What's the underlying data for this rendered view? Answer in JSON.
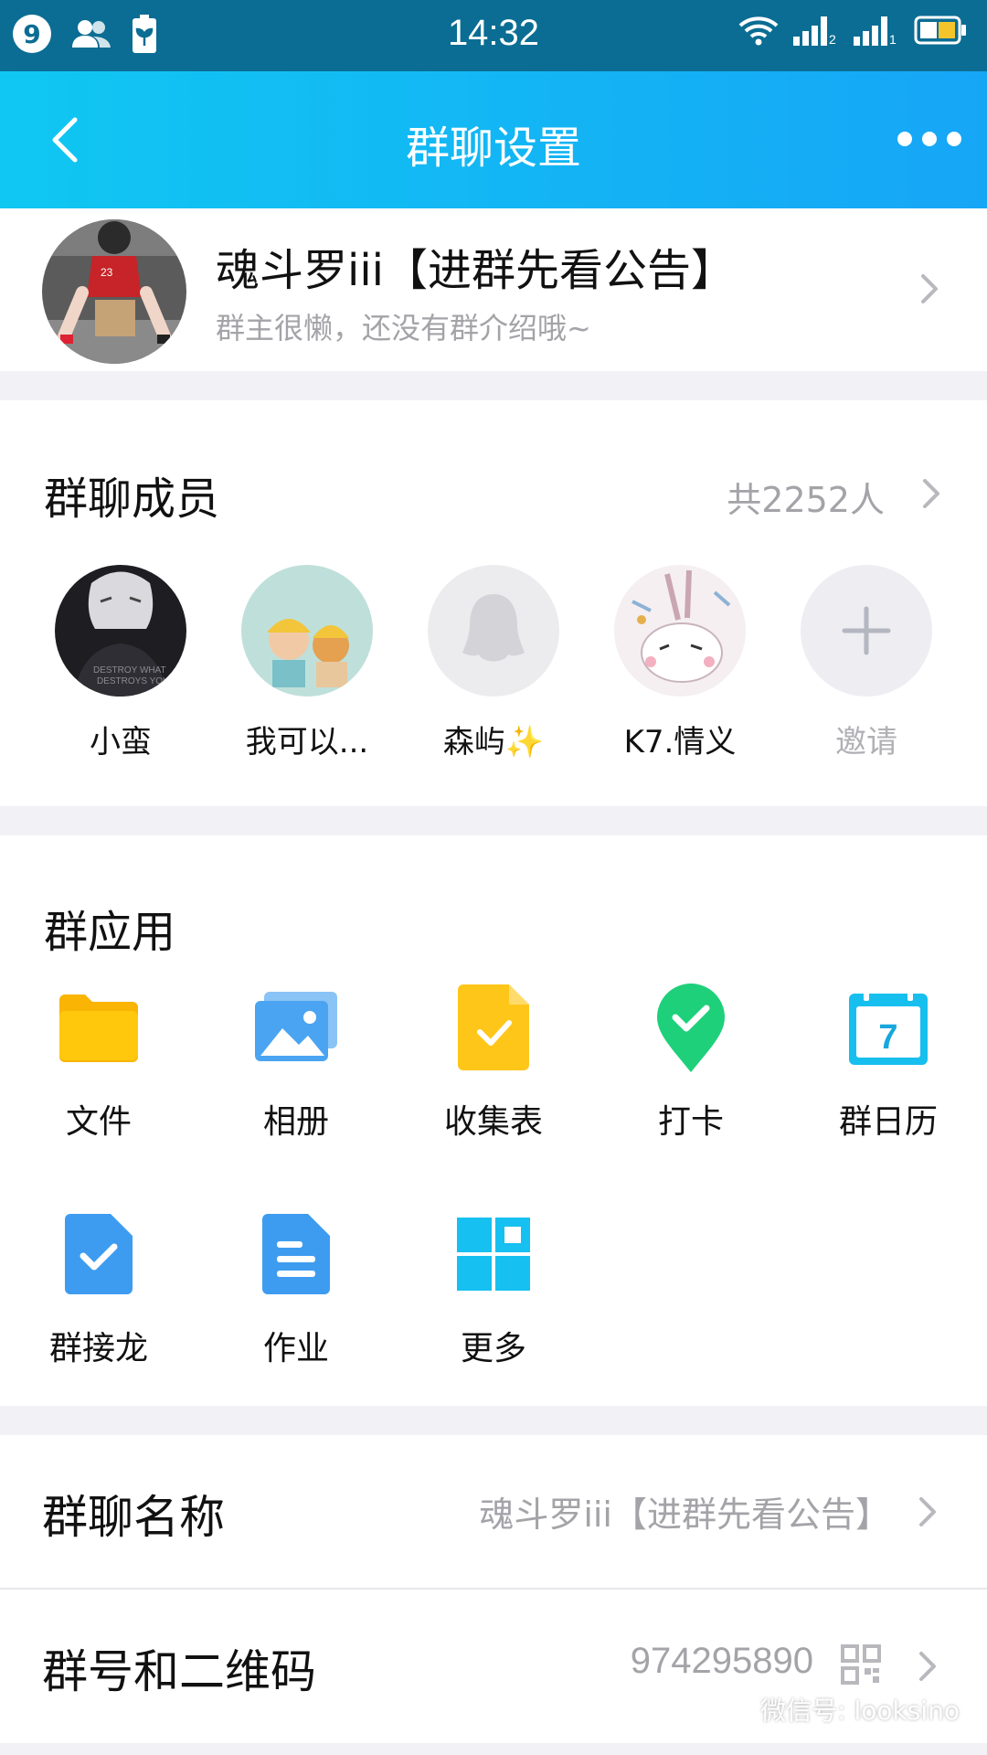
{
  "status_bar": {
    "notification_count": "9",
    "time": "14:32",
    "icons": [
      "contacts-icon",
      "battery-saver-icon",
      "wifi-icon",
      "signal-icon",
      "signal-icon",
      "battery-icon"
    ]
  },
  "nav": {
    "title": "群聊设置",
    "back_icon": "chevron-left-icon",
    "more_icon": "more-dots-icon"
  },
  "group": {
    "name": "魂斗罗iii【进群先看公告】",
    "intro": "群主很懒，还没有群介绍哦~"
  },
  "members": {
    "title": "群聊成员",
    "count": "共2252人",
    "items": [
      {
        "name": "小蛮"
      },
      {
        "name": "我可以..."
      },
      {
        "name": "森屿✨"
      },
      {
        "name": "K7.情义"
      },
      {
        "name": "邀请"
      }
    ]
  },
  "apps": {
    "title": "群应用",
    "items": [
      {
        "label": "文件",
        "icon": "folder-icon"
      },
      {
        "label": "相册",
        "icon": "photo-album-icon"
      },
      {
        "label": "收集表",
        "icon": "form-icon"
      },
      {
        "label": "打卡",
        "icon": "check-in-icon"
      },
      {
        "label": "群日历",
        "icon": "calendar-icon"
      },
      {
        "label": "群接龙",
        "icon": "relay-icon"
      },
      {
        "label": "作业",
        "icon": "homework-icon"
      },
      {
        "label": "更多",
        "icon": "more-grid-icon"
      }
    ],
    "calendar_day": "7"
  },
  "settings": {
    "group_name_label": "群聊名称",
    "group_name_value": "魂斗罗iii【进群先看公告】",
    "group_number_label": "群号和二维码",
    "group_number_value": "974295890"
  },
  "watermark": "微信号: looksino",
  "colors": {
    "nav_start": "#10c7f2",
    "nav_end": "#16a6f6",
    "status_bar": "#0b6d93",
    "text_secondary": "#a3a3a8"
  }
}
